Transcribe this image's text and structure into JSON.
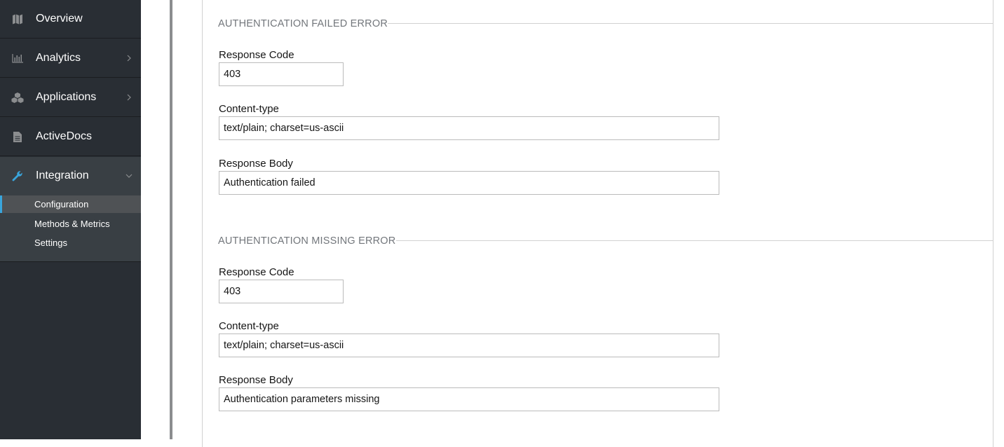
{
  "sidebar": {
    "items": [
      {
        "label": "Overview",
        "icon": "map-icon",
        "has_chevron": false
      },
      {
        "label": "Analytics",
        "icon": "bar-chart-icon",
        "has_chevron": true
      },
      {
        "label": "Applications",
        "icon": "cubes-icon",
        "has_chevron": true
      },
      {
        "label": "ActiveDocs",
        "icon": "document-icon",
        "has_chevron": false
      },
      {
        "label": "Integration",
        "icon": "wrench-icon",
        "has_chevron": true,
        "expanded": true
      }
    ],
    "subitems": [
      {
        "label": "Configuration",
        "current": true
      },
      {
        "label": "Methods & Metrics"
      },
      {
        "label": "Settings"
      }
    ]
  },
  "sections": [
    {
      "title": "AUTHENTICATION FAILED ERROR",
      "response_code_label": "Response Code",
      "response_code": "403",
      "content_type_label": "Content-type",
      "content_type": "text/plain; charset=us-ascii",
      "response_body_label": "Response Body",
      "response_body": "Authentication failed"
    },
    {
      "title": "AUTHENTICATION MISSING ERROR",
      "response_code_label": "Response Code",
      "response_code": "403",
      "content_type_label": "Content-type",
      "content_type": "text/plain; charset=us-ascii",
      "response_body_label": "Response Body",
      "response_body": "Authentication parameters missing"
    }
  ],
  "colors": {
    "sidebar_bg": "#292e34",
    "active_accent": "#39a5dc",
    "legend_text": "#72767b"
  }
}
